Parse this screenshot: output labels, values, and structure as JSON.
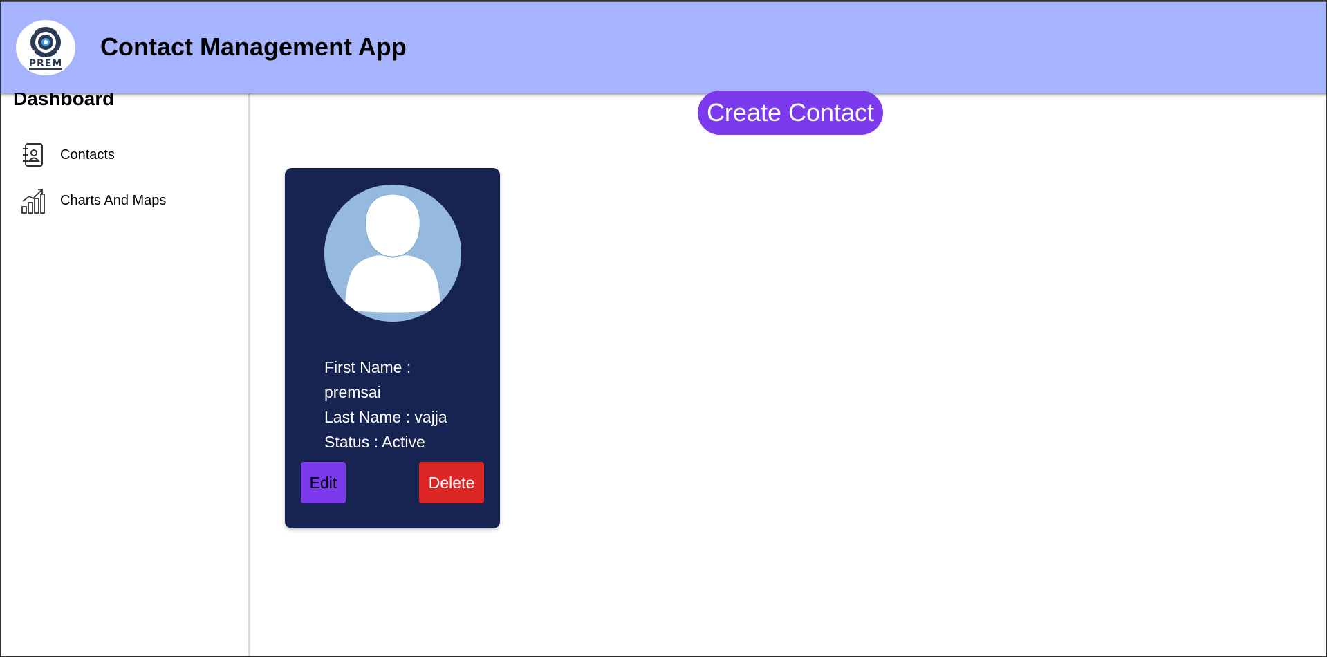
{
  "header": {
    "logo_text": "PREM",
    "title": "Contact Management App"
  },
  "sidebar": {
    "title": "Dashboard",
    "items": [
      {
        "label": "Contacts",
        "icon": "contacts-book-icon"
      },
      {
        "label": "Charts And Maps",
        "icon": "bar-chart-trend-icon"
      }
    ]
  },
  "main": {
    "create_label": "Create Contact",
    "contacts": [
      {
        "first_name_line": "First Name : premsai",
        "last_name_line": "Last Name : vajja",
        "status_line": "Status : Active",
        "edit_label": "Edit",
        "delete_label": "Delete"
      }
    ]
  },
  "colors": {
    "header_bg": "#a5b4fc",
    "accent_purple": "#7c3aed",
    "card_bg": "#172350",
    "delete_red": "#dc2626",
    "avatar_bg": "#95bade"
  }
}
